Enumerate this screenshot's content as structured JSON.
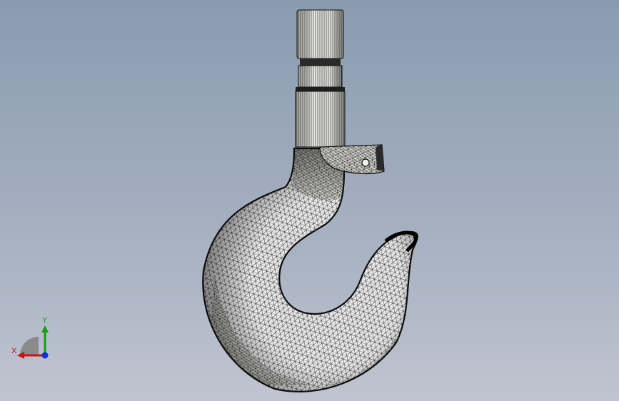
{
  "viewport": {
    "model_name": "crane-hook",
    "render_style": "shaded-with-mesh-edges",
    "background_top": "#8a9bb0",
    "background_bottom": "#c0c4d0"
  },
  "triad": {
    "x_label": "X",
    "y_label": "Y",
    "x_color": "#d01010",
    "y_color": "#10a010",
    "z_color": "#1030e0"
  }
}
